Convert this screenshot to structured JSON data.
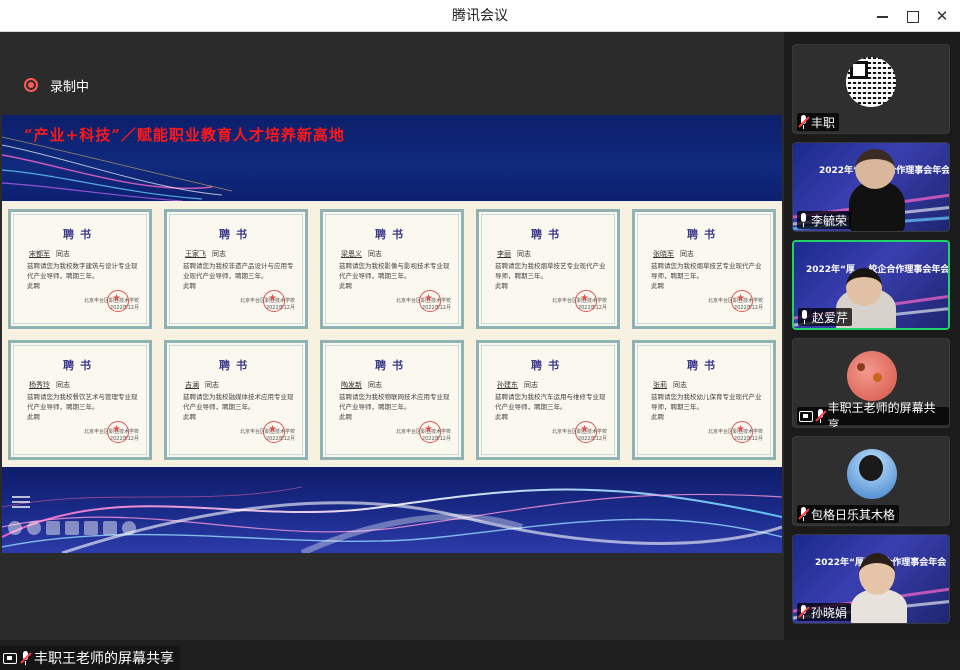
{
  "window": {
    "title": "腾讯会议"
  },
  "recording": {
    "label": "录制中"
  },
  "slide": {
    "banner_title": "“产业+科技”／赋能职业教育人才培养新高地",
    "certificates": [
      {
        "heading": "聘书",
        "name": "宋都军",
        "suffix": "同志",
        "body": "兹聘请您为我校数字建筑与设计专业现代产业导师，聘期三年。",
        "close": "此聘",
        "issuer": "北京丰台区职业技术学校",
        "date": "2022年12月"
      },
      {
        "heading": "聘书",
        "name": "王家飞",
        "suffix": "同志",
        "body": "兹聘请您为我校非遗产品设计与应用专业现代产业导师，聘期三年。",
        "close": "此聘",
        "issuer": "北京丰台区职业技术学校",
        "date": "2022年12月"
      },
      {
        "heading": "聘书",
        "name": "梁恩义",
        "suffix": "同志",
        "body": "兹聘请您为我校影像与影视技术专业现代产业导师，聘期三年。",
        "close": "此聘",
        "issuer": "北京丰台区职业技术学校",
        "date": "2022年12月"
      },
      {
        "heading": "聘书",
        "name": "李丽",
        "suffix": "同志",
        "body": "兹聘请您为我校烟草技艺专业现代产业导师，聘期三年。",
        "close": "此聘",
        "issuer": "北京丰台区职业技术学校",
        "date": "2022年12月"
      },
      {
        "heading": "聘书",
        "name": "张晓军",
        "suffix": "同志",
        "body": "兹聘请您为我校烟草技艺专业现代产业导师，聘期三年。",
        "close": "此聘",
        "issuer": "北京丰台区职业技术学校",
        "date": "2022年12月"
      },
      {
        "heading": "聘书",
        "name": "杨秀玲",
        "suffix": "同志",
        "body": "兹聘请您为我校餐饮艺术与管理专业现代产业导师，聘期三年。",
        "close": "此聘",
        "issuer": "北京丰台区职业技术学校",
        "date": "2022年12月"
      },
      {
        "heading": "聘书",
        "name": "吉澜",
        "suffix": "同志",
        "body": "兹聘请您为我校融媒体技术应用专业现代产业导师，聘期三年。",
        "close": "此聘",
        "issuer": "北京丰台区职业技术学校",
        "date": "2022年12月"
      },
      {
        "heading": "聘书",
        "name": "陶发新",
        "suffix": "同志",
        "body": "兹聘请您为我校物联网技术应用专业现代产业导师，聘期三年。",
        "close": "此聘",
        "issuer": "北京丰台区职业技术学校",
        "date": "2022年12月"
      },
      {
        "heading": "聘书",
        "name": "孙建东",
        "suffix": "同志",
        "body": "兹聘请您为我校汽车运用与维修专业现代产业导师，聘期三年。",
        "close": "此聘",
        "issuer": "北京丰台区职业技术学校",
        "date": "2022年12月"
      },
      {
        "heading": "聘书",
        "name": "张莉",
        "suffix": "同志",
        "body": "兹聘请您为我校幼儿保育专业现代产业导师，聘期三年。",
        "close": "此聘",
        "issuer": "北京丰台区职业技术学校",
        "date": "2022年12月"
      }
    ]
  },
  "share": {
    "label": "丰职王老师的屏幕共享"
  },
  "participants": [
    {
      "name": "丰职",
      "kind": "qr"
    },
    {
      "name": "李毓荣",
      "kind": "video",
      "banner": "2022年“厚德...合作理事会年会"
    },
    {
      "name": "赵爱芹",
      "kind": "video",
      "banner": "2022年“厚... 校企合作理事会年会",
      "active": true
    },
    {
      "name": "丰职王老师的屏幕共享",
      "kind": "avatar"
    },
    {
      "name": "包格日乐其木格",
      "kind": "avatar"
    },
    {
      "name": "孙晓娟",
      "kind": "video",
      "banner": "2022年“厚德...合作理事会年会"
    }
  ],
  "colors": {
    "banner_title": "#ff1818",
    "active_border": "#1fd36a",
    "record": "#ff5a5a",
    "slide_banner": "#0c1f6b"
  }
}
